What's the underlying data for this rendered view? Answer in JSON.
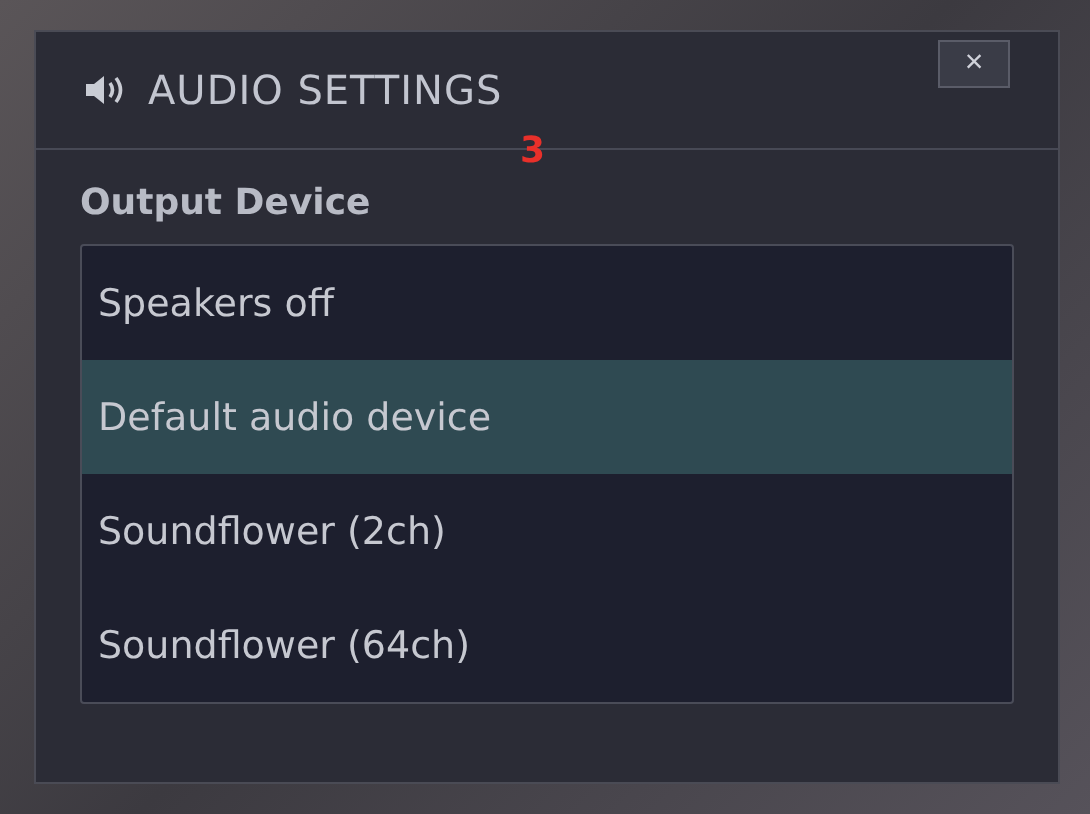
{
  "dialog": {
    "title": "AUDIO SETTINGS",
    "close": "×",
    "annotation": "3"
  },
  "output_device": {
    "label": "Output Device",
    "options": [
      {
        "label": "Speakers off",
        "selected": false
      },
      {
        "label": "Default audio device",
        "selected": true
      },
      {
        "label": "Soundflower (2ch)",
        "selected": false
      },
      {
        "label": "Soundflower (64ch)",
        "selected": false
      }
    ]
  }
}
